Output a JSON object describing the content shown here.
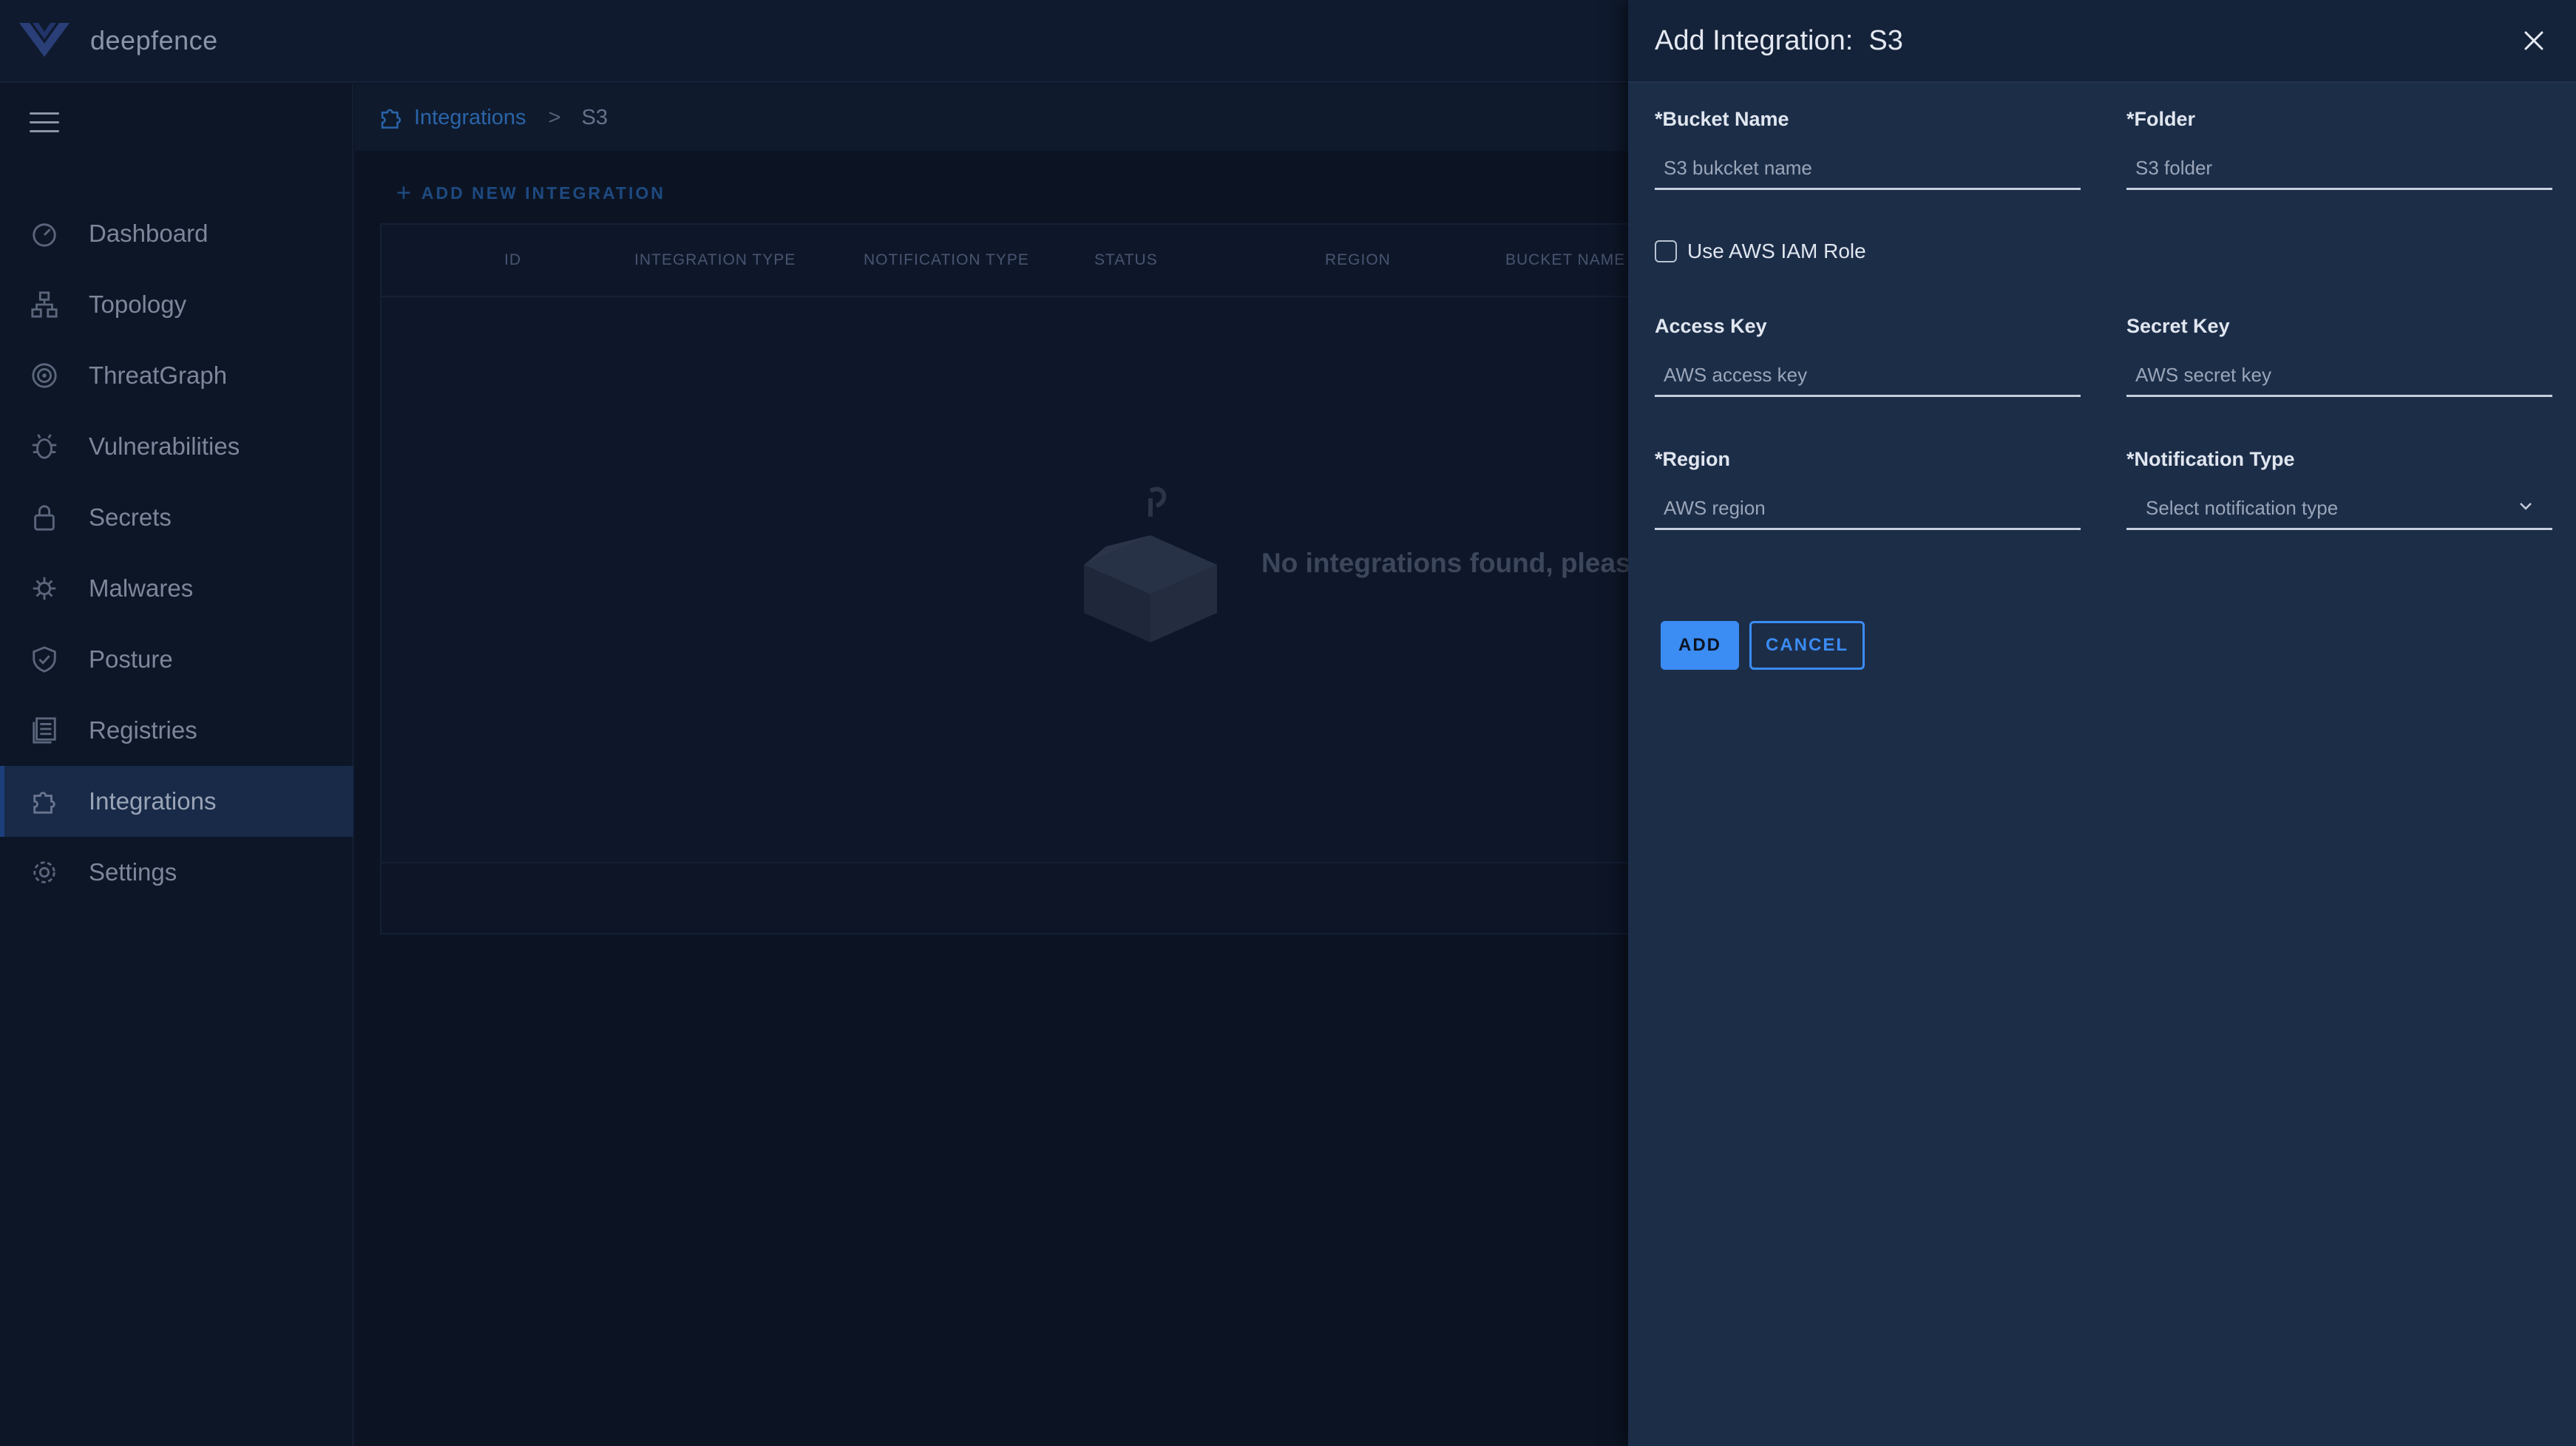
{
  "app": {
    "brand_name": "deepfence"
  },
  "sidebar": {
    "items": [
      {
        "label": "Dashboard",
        "icon": "dashboard-icon"
      },
      {
        "label": "Topology",
        "icon": "topology-icon"
      },
      {
        "label": "ThreatGraph",
        "icon": "threatgraph-icon"
      },
      {
        "label": "Vulnerabilities",
        "icon": "bug-icon"
      },
      {
        "label": "Secrets",
        "icon": "lock-icon"
      },
      {
        "label": "Malwares",
        "icon": "malware-icon"
      },
      {
        "label": "Posture",
        "icon": "shield-icon"
      },
      {
        "label": "Registries",
        "icon": "registries-icon"
      },
      {
        "label": "Integrations",
        "icon": "puzzle-icon",
        "active": true
      },
      {
        "label": "Settings",
        "icon": "gear-icon"
      }
    ]
  },
  "breadcrumb": {
    "link": "Integrations",
    "separator": ">",
    "current": "S3"
  },
  "main": {
    "add_new_label": "ADD NEW INTEGRATION",
    "table": {
      "columns": [
        "ID",
        "INTEGRATION TYPE",
        "NOTIFICATION TYPE",
        "STATUS",
        "REGION",
        "BUCKET NAME"
      ]
    },
    "empty_message": "No integrations found, please a"
  },
  "drawer": {
    "title": "Add Integration:  S3",
    "fields": {
      "bucket_name": {
        "label": "*Bucket Name",
        "placeholder": "S3 bukcket name",
        "value": ""
      },
      "folder": {
        "label": "*Folder",
        "placeholder": "S3 folder",
        "value": ""
      },
      "access_key": {
        "label": "Access Key",
        "placeholder": "AWS access key",
        "value": ""
      },
      "secret_key": {
        "label": "Secret Key",
        "placeholder": "AWS secret key",
        "value": ""
      },
      "region": {
        "label": "*Region",
        "placeholder": "AWS region",
        "value": ""
      },
      "notification_type": {
        "label": "*Notification Type",
        "placeholder": "Select notification type"
      }
    },
    "iam_role": {
      "label": "Use AWS IAM Role",
      "checked": false
    },
    "add_label": "ADD",
    "cancel_label": "CANCEL"
  },
  "colors": {
    "accent": "#3b8cf3",
    "drawer_bg": "#1c2d48",
    "page_bg": "#0e1628"
  }
}
